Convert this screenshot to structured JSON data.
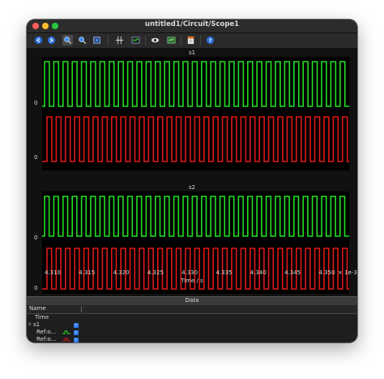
{
  "window": {
    "title": "untitled1/Circuit/Scope1"
  },
  "toolbar": {
    "icons": [
      "back-icon",
      "forward-icon",
      "zoom-in-icon",
      "zoom-out-icon",
      "zoom-fit-icon",
      "cursor-icon",
      "plot-icon",
      "view-icon",
      "export-icon",
      "settings-icon",
      "help-icon"
    ]
  },
  "plots": [
    {
      "title": "s1",
      "ytick1": "0",
      "ytick2": "0"
    },
    {
      "title": "s2",
      "ytick1": "0",
      "ytick2": "0"
    }
  ],
  "xaxis": {
    "ticks": [
      "4.310",
      "4.315",
      "4.320",
      "4.325",
      "4.330",
      "4.335",
      "4.340",
      "4.345",
      "4.350"
    ],
    "label": "Time / s",
    "exponent": "× 1e-3"
  },
  "colors": {
    "green": "#22e022",
    "red": "#e01818"
  },
  "data_panel": {
    "title": "Data",
    "column_name": "Name",
    "rows": [
      {
        "label": "Time",
        "indent": 10,
        "caret": "",
        "check": false
      },
      {
        "label": "s1",
        "indent": 8,
        "caret": "v",
        "check": true
      },
      {
        "label": "Ref:o...",
        "indent": 12,
        "caret": "",
        "check": true,
        "swatch": "#22e022"
      },
      {
        "label": "Ref:o...",
        "indent": 12,
        "caret": "",
        "check": true,
        "swatch": "#e01818"
      }
    ]
  }
}
